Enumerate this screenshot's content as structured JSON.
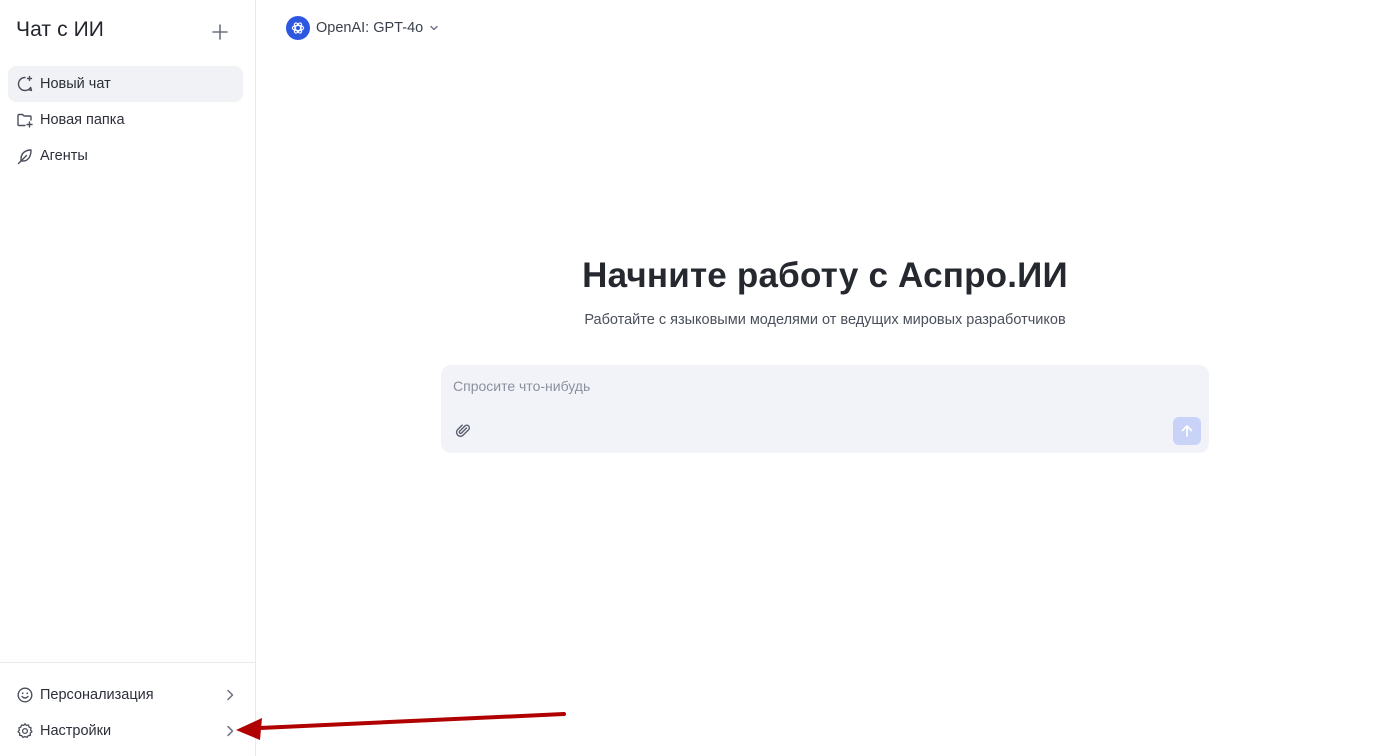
{
  "sidebar": {
    "title": "Чат с ИИ",
    "new_chat_icon": "plus-icon",
    "items": [
      {
        "label": "Новый чат",
        "icon": "chat-plus-icon",
        "active": true
      },
      {
        "label": "Новая папка",
        "icon": "folder-plus-icon",
        "active": false
      },
      {
        "label": "Агенты",
        "icon": "feather-icon",
        "active": false
      }
    ],
    "footer": [
      {
        "label": "Персонализация",
        "icon": "smile-icon"
      },
      {
        "label": "Настройки",
        "icon": "gear-icon"
      }
    ]
  },
  "header": {
    "model_label": "OpenAI: GPT-4o",
    "model_icon": "openai-logo-icon"
  },
  "hero": {
    "title": "Начните работу с Аспро.ИИ",
    "subtitle": "Работайте с языковыми моделями от ведущих мировых разработчиков"
  },
  "composer": {
    "placeholder": "Спросите что-нибудь",
    "value": "",
    "attach_icon": "paperclip-icon",
    "send_icon": "arrow-up-icon"
  },
  "colors": {
    "accent": "#2e57e0",
    "send_disabled": "#c9d3f7",
    "composer_bg": "#f2f3f8",
    "active_item_bg": "#f1f2f6",
    "annotation_arrow": "#b00000"
  }
}
